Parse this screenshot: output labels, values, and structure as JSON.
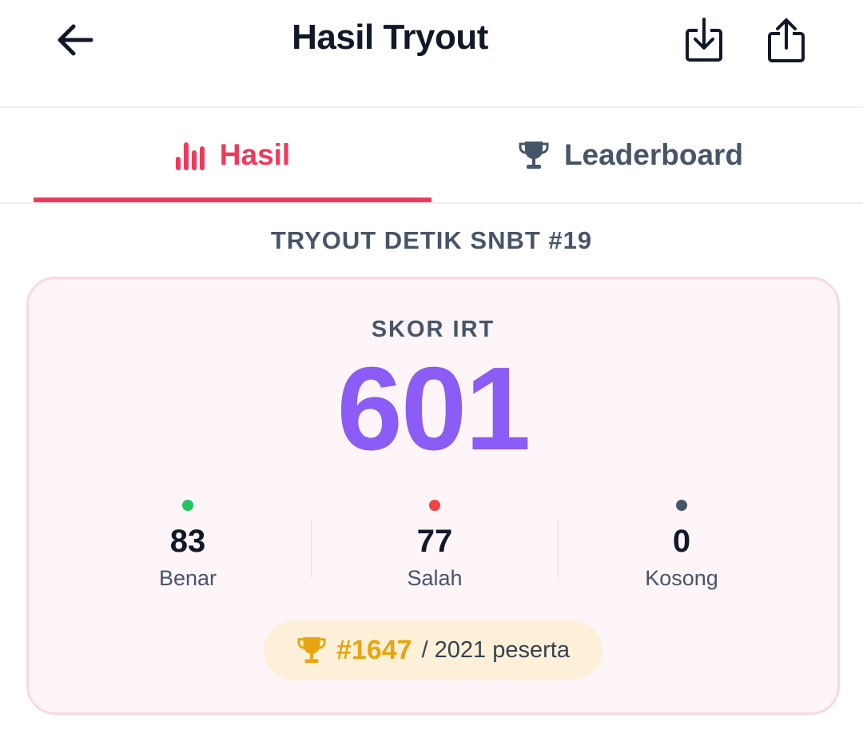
{
  "header": {
    "title": "Hasil Tryout",
    "back_icon": "arrow-left-icon",
    "download_icon": "download-icon",
    "share_icon": "share-icon"
  },
  "tabs": [
    {
      "label": "Hasil",
      "icon": "bar-chart-icon",
      "active": true
    },
    {
      "label": "Leaderboard",
      "icon": "trophy-icon",
      "active": false
    }
  ],
  "tryout_name": "TRYOUT DETIK SNBT #19",
  "score": {
    "label": "SKOR IRT",
    "value": "601"
  },
  "stats": [
    {
      "value": "83",
      "label": "Benar",
      "color": "#22c55e"
    },
    {
      "value": "77",
      "label": "Salah",
      "color": "#ef4444"
    },
    {
      "value": "0",
      "label": "Kosong",
      "color": "#475569"
    }
  ],
  "rank": {
    "position": "#1647",
    "total": "/ 2021 peserta",
    "icon": "trophy-icon"
  },
  "colors": {
    "accent": "#ee3a5c",
    "score": "#8b5cf6",
    "rank": "#e7a60f",
    "card_bg": "#fdf5f7"
  }
}
